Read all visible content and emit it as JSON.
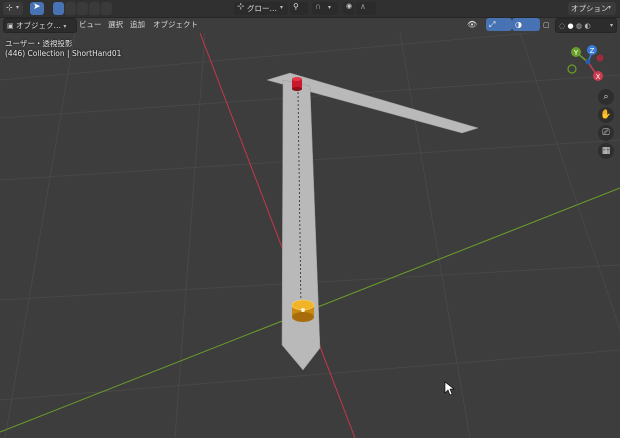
{
  "header": {
    "mode_menu": "オブジェク…",
    "view_menu": "ビュー",
    "select_menu": "選択",
    "add_menu": "追加",
    "object_menu": "オブジェクト",
    "transform_orientation": "グロー…",
    "options_menu": "オプション"
  },
  "viewport": {
    "view_label": "ユーザー・透視投影",
    "collection_label": "(446) Collection | ShortHand01"
  },
  "gizmo": {
    "x": "X",
    "y": "Y",
    "z": "Z"
  },
  "colors": {
    "x_axis": "#cf3a4e",
    "y_axis": "#6a9e2a",
    "z_axis": "#3a7ad8",
    "object_fill": "#b9b9b9",
    "selected_origin": "#e4a21b",
    "red_pivot": "#c8182b"
  }
}
